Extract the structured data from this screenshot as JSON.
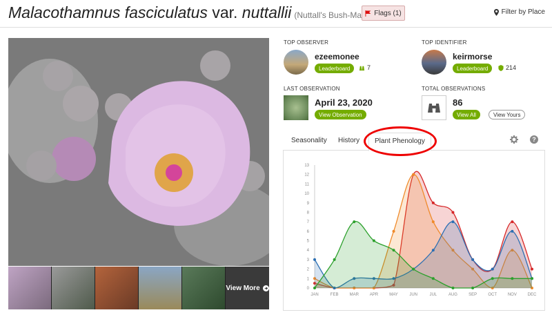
{
  "header": {
    "title_genus": "Malacothamnus fasciculatus",
    "title_rank": "var.",
    "title_infra": "nuttallii",
    "common_name": "(Nuttall's Bush-Mallow)",
    "flags_label": "Flags (1)",
    "filter_label": "Filter by Place",
    "flag_color": "#d11"
  },
  "gallery": {
    "view_more_label": "View More"
  },
  "stats": {
    "top_observer": {
      "label": "TOP OBSERVER",
      "name": "ezeemonee",
      "button": "Leaderboard",
      "count": "7"
    },
    "top_identifier": {
      "label": "TOP IDENTIFIER",
      "name": "keirmorse",
      "button": "Leaderboard",
      "count": "214"
    },
    "last_observation": {
      "label": "LAST OBSERVATION",
      "date": "April 23, 2020",
      "button": "View Observation"
    },
    "total_observations": {
      "label": "TOTAL OBSERVATIONS",
      "count": "86",
      "view_all": "View All",
      "view_yours": "View Yours"
    }
  },
  "tabs": {
    "seasonality": "Seasonality",
    "history": "History",
    "plant_phenology": "Plant Phenology"
  },
  "colors": {
    "accent": "#74ac00"
  },
  "chart_data": {
    "type": "area",
    "x": [
      "JAN",
      "FEB",
      "MAR",
      "APR",
      "MAY",
      "JUN",
      "JUL",
      "AUG",
      "SEP",
      "OCT",
      "NOV",
      "DEC"
    ],
    "ylim": [
      0,
      13
    ],
    "yticks": [
      0,
      1,
      2,
      3,
      4,
      5,
      6,
      7,
      8,
      9,
      10,
      11,
      12,
      13
    ],
    "series": [
      {
        "color": "#d62728",
        "values": [
          0.5,
          0,
          0,
          0,
          0.3,
          12,
          9,
          8,
          3,
          2,
          7,
          2
        ]
      },
      {
        "color": "#ef8a2a",
        "values": [
          1,
          0,
          0,
          0,
          6,
          12,
          7,
          4,
          2,
          0,
          4,
          0
        ]
      },
      {
        "color": "#2b6fb3",
        "values": [
          3,
          0,
          1,
          1,
          1,
          2,
          4,
          7,
          3,
          2,
          6,
          1
        ]
      },
      {
        "color": "#2ca02c",
        "values": [
          0,
          3,
          7,
          5,
          4,
          2,
          1,
          0,
          0,
          1,
          1,
          1
        ]
      }
    ]
  }
}
